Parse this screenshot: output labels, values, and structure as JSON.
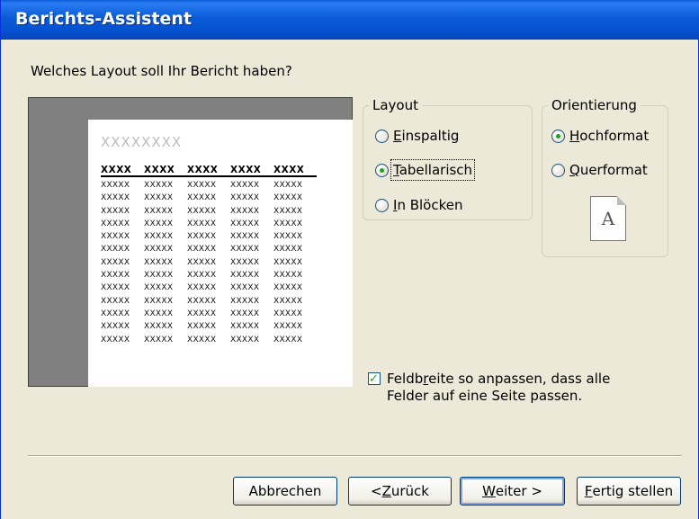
{
  "window": {
    "title": "Berichts-Assistent"
  },
  "question": "Welches Layout soll Ihr Bericht haben?",
  "preview": {
    "title_placeholder": "XXXXXXXX",
    "header_cells": [
      "XXXX",
      "XXXX",
      "XXXX",
      "XXXX",
      "XXXX"
    ],
    "row_cells": [
      "XXXXX",
      "XXXXX",
      "XXXXX",
      "XXXXX",
      "XXXXX"
    ],
    "row_count": 13
  },
  "layout": {
    "legend": "Layout",
    "options": [
      {
        "label": "Einspaltig",
        "accel": "E",
        "rest": "inspaltig",
        "selected": false
      },
      {
        "label": "Tabellarisch",
        "accel": "T",
        "rest": "abellarisch",
        "selected": true
      },
      {
        "label": "In Blöcken",
        "accel": "I",
        "rest": "n Blöcken",
        "selected": false
      }
    ]
  },
  "orientation": {
    "legend": "Orientierung",
    "options": [
      {
        "label": "Hochformat",
        "accel": "H",
        "rest": "ochformat",
        "selected": true
      },
      {
        "label": "Querformat",
        "accel": "Q",
        "rest": "uerformat",
        "selected": false
      }
    ],
    "icon_letter": "A"
  },
  "fit_checkbox": {
    "checked": true,
    "line1_pre": "Feldb",
    "line1_accel": "r",
    "line1_post": "eite so anpassen, dass alle",
    "line2": "Felder auf eine Seite passen."
  },
  "buttons": {
    "cancel": "Abbrechen",
    "back_pre": "< ",
    "back_accel": "Z",
    "back_post": "urück",
    "next_accel": "W",
    "next_post": "eiter >",
    "finish_accel": "F",
    "finish_post": "ertig stellen"
  },
  "colors": {
    "title_bar": "#0a5bd9",
    "dialog_bg": "#ece9d8",
    "check_green": "#21a121"
  }
}
